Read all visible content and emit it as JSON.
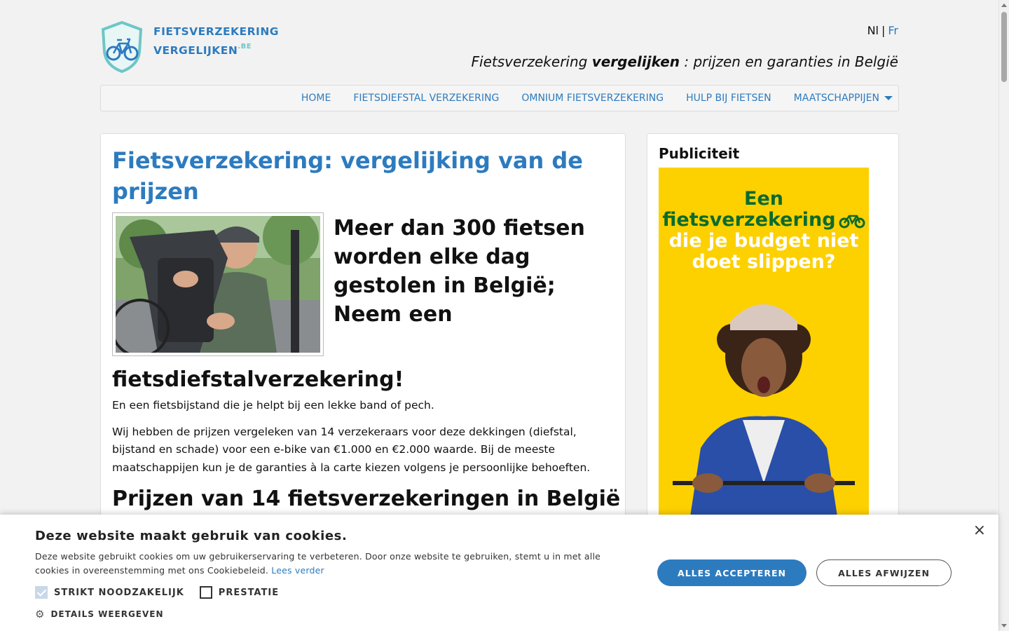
{
  "logo": {
    "line1": "FIETSVERZEKERING",
    "line2": "VERGELIJKEN",
    "tld": ".BE",
    "icon": "shield-bicycle-icon"
  },
  "lang": {
    "nl": "Nl",
    "separator": "|",
    "fr": "Fr"
  },
  "tagline": {
    "part1": "Fietsverzekering ",
    "bold": "vergelijken",
    "part2": " : prijzen en garanties in België"
  },
  "nav": {
    "items": [
      "HOME",
      "FIETSDIEFSTAL VERZEKERING",
      "OMNIUM FIETSVERZEKERING",
      "HULP BIJ FIETSEN",
      "MAATSCHAPPIJEN"
    ],
    "dropdown_icon": "caret-down-icon"
  },
  "main": {
    "title": "Fietsverzekering: vergelijking van de prijzen",
    "subhead": "Meer dan 300 fietsen worden elke dag gestolen in België; Neem een",
    "subhead2": "fietsdiefstalverzekering!",
    "p1": "En een fietsbijstand die je helpt bij een lekke band of pech.",
    "p2": "Wij hebben de prijzen vergeleken van 14 verzekeraars voor deze dekkingen (diefstal, bijstand en schade) voor een e-bike van €1.000 en €2.000 waarde. Bij de meeste maatschappijen kun je de garanties à la carte kiezen volgens je persoonlijke behoeften.",
    "h2": "Prijzen van 14 fietsverzekeringen in België"
  },
  "side": {
    "title": "Publiciteit",
    "ad": {
      "line1": "Een",
      "line2": "fietsverzekering",
      "line3": "die je budget niet",
      "line4": "doet slippen?"
    }
  },
  "cookie": {
    "title": "Deze website maakt gebruik van cookies.",
    "desc": "Deze website gebruikt cookies om uw gebruikerservaring te verbeteren. Door onze website te gebruiken, stemt u in met alle cookies in overeenstemming met ons Cookiebeleid.",
    "link": "Lees verder",
    "cb_strict": "STRIKT NOODZAKELIJK",
    "cb_perf": "PRESTATIE",
    "details": "DETAILS WEERGEVEN",
    "accept": "ALLES ACCEPTEREN",
    "reject": "ALLES AFWIJZEN",
    "close": "×"
  },
  "colors": {
    "accent": "#2d7bbf",
    "logo_teal": "#6ec6c6",
    "ad_yellow": "#fdd000",
    "ad_green": "#0b6b2e"
  }
}
